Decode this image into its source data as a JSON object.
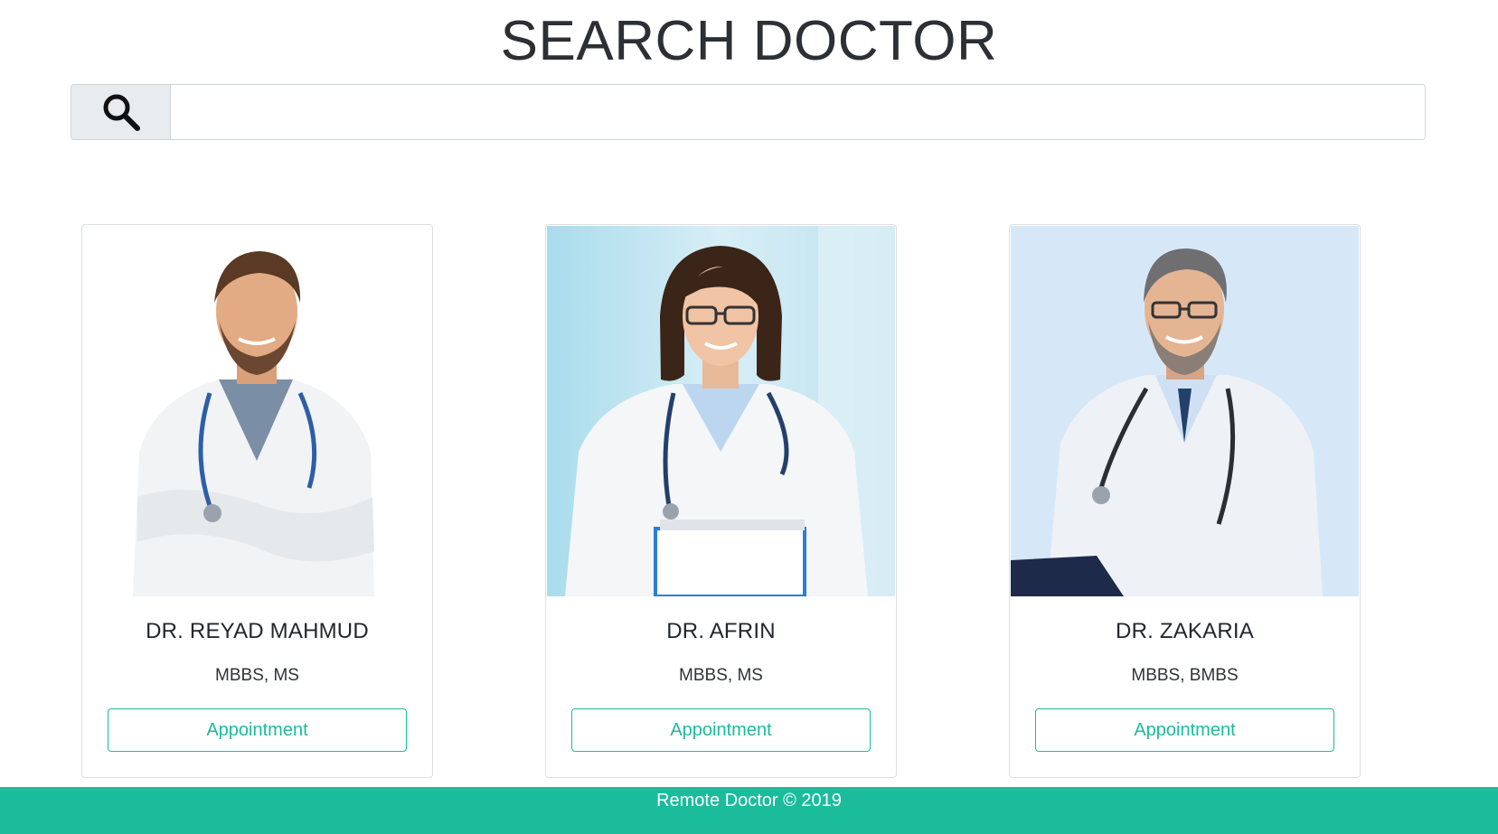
{
  "page": {
    "title": "SEARCH DOCTOR"
  },
  "search": {
    "placeholder": "",
    "value": "",
    "icon": "search-icon"
  },
  "doctors": [
    {
      "name": "DR. REYAD MAHMUD",
      "degree": "MBBS, MS",
      "button_label": "Appointment",
      "photo_background": "#ffffff"
    },
    {
      "name": "DR. AFRIN",
      "degree": "MBBS, MS",
      "button_label": "Appointment",
      "photo_background": "#cfe9f3"
    },
    {
      "name": "DR. ZAKARIA",
      "degree": "MBBS, BMBS",
      "button_label": "Appointment",
      "photo_background": "#d6e8f8"
    }
  ],
  "footer": {
    "text": "Remote Doctor © 2019"
  },
  "colors": {
    "accent": "#1abc9c",
    "title": "#2c2f33"
  }
}
